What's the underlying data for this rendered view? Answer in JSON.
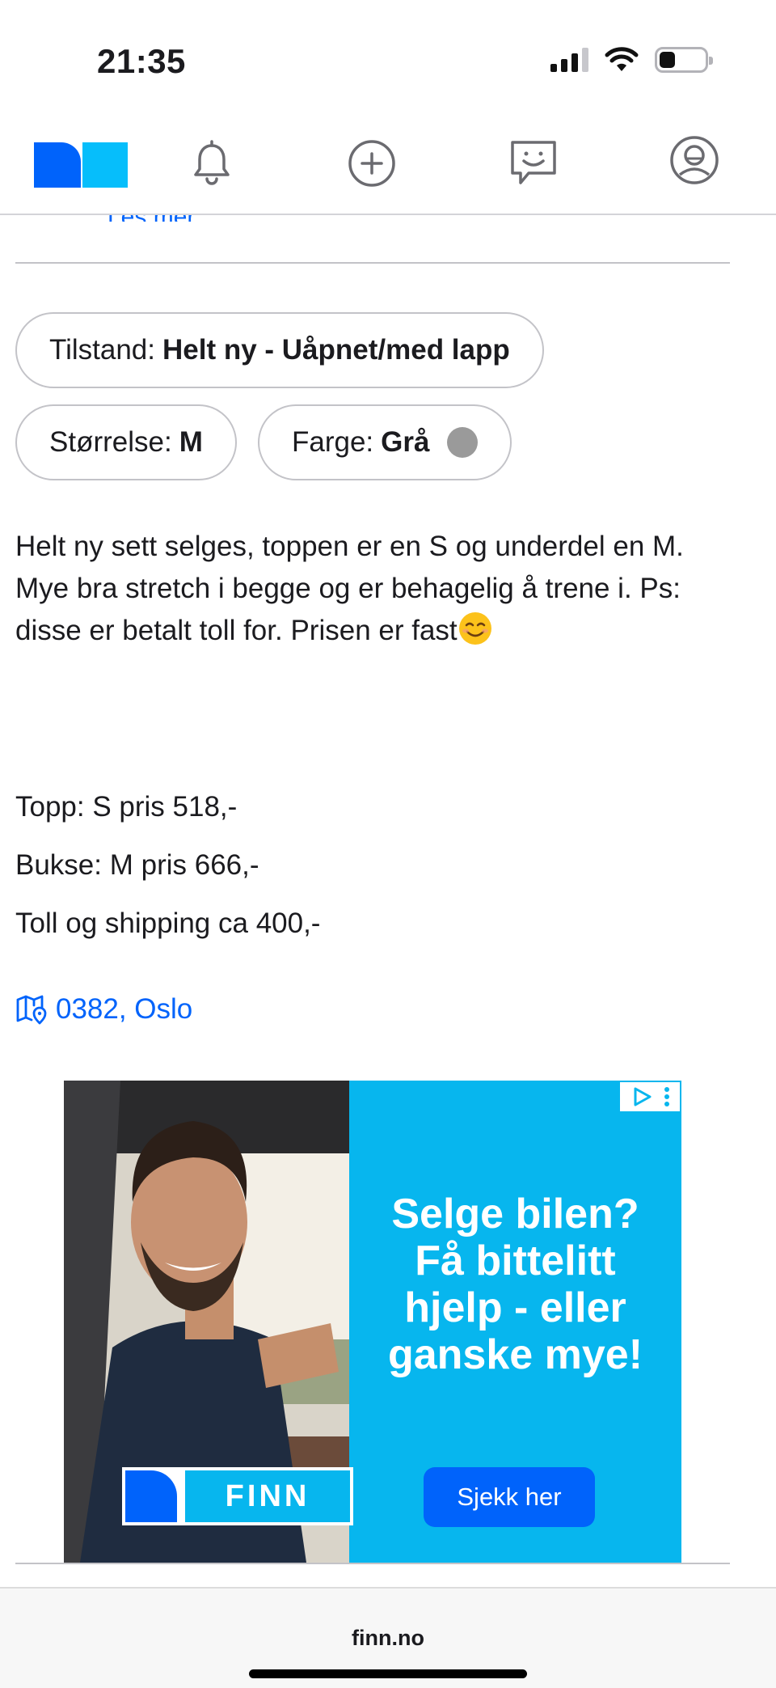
{
  "status_bar": {
    "time": "21:35",
    "battery_level": 0.35
  },
  "nav": {
    "logo_colors": [
      "#0063fb",
      "#06befb"
    ],
    "icons": [
      "notifications-bell-icon",
      "new-ad-plus-icon",
      "messages-chat-icon",
      "profile-avatar-icon"
    ]
  },
  "listing": {
    "see_more_label": "Les mer",
    "attributes": {
      "condition": {
        "label": "Tilstand:",
        "value": "Helt ny - Uåpnet/med lapp"
      },
      "size": {
        "label": "Størrelse:",
        "value": "M"
      },
      "color": {
        "label": "Farge:",
        "value": "Grå",
        "swatch": "#9a9a9a"
      }
    },
    "description": {
      "text": "Helt ny sett selges, toppen er en S og underdel en M. Mye bra stretch i begge og er behagelig å trene i. Ps: disse er betalt toll for. Prisen er fast",
      "emoji": "smiling-face-icon"
    },
    "price_lines": [
      "Topp: S pris 518,-",
      "Bukse: M pris 666,-",
      "Toll og shipping ca 400,-"
    ],
    "location": {
      "label": "0382, Oslo",
      "icon": "map-pin-icon"
    }
  },
  "ad": {
    "headline_lines": [
      "Selge bilen?",
      "Få bittelitt",
      "hjelp - eller",
      "ganske mye!"
    ],
    "cta_label": "Sjekk her",
    "brand": "FINN",
    "colors": {
      "panel": "#07b6ee",
      "cta": "#0063fb"
    }
  },
  "browser": {
    "url": "finn.no"
  },
  "colors": {
    "link": "#0063fb",
    "border": "#c3c3c8",
    "text": "#1b1b1f"
  }
}
